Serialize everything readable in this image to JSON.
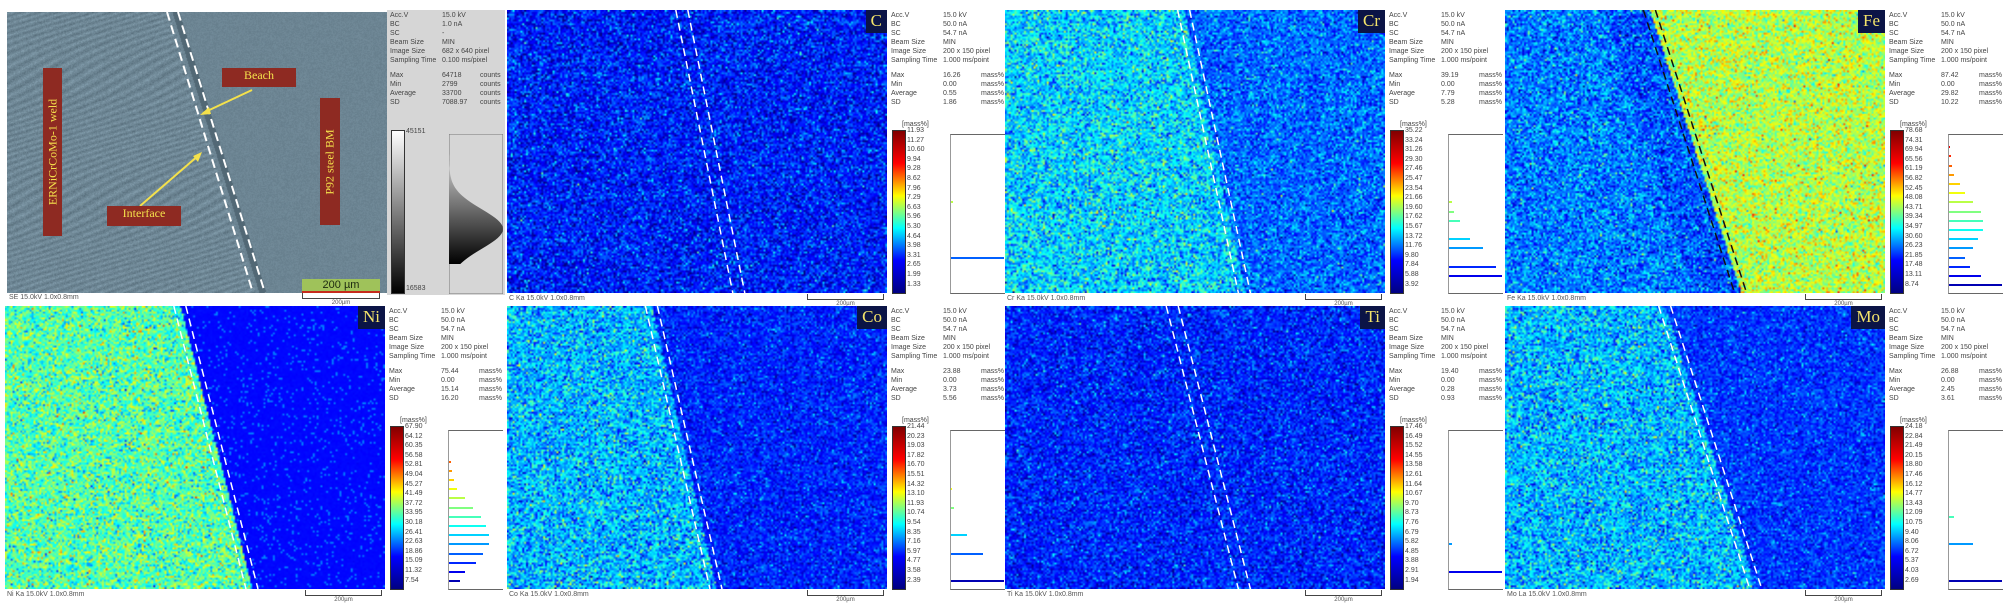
{
  "sem": {
    "labels": {
      "weld": "ERNiCrCoMo-1 weld",
      "beach": "Beach",
      "interface": "Interface",
      "base_metal": "P92 steel BM"
    },
    "scale_bar_label": "200 µm",
    "footer": "SE 15.0kV 1.0x0.8mm",
    "small_scale": "200µm",
    "params": [
      [
        "Acc.V",
        "15.0 kV"
      ],
      [
        "BC",
        "1.0 nA"
      ],
      [
        "SC",
        "-"
      ],
      [
        "Beam Size",
        "MIN"
      ],
      [
        "Image Size",
        "682 x 640 pixel"
      ],
      [
        "Sampling Time",
        "0.100 ms/pixel"
      ]
    ],
    "stats": [
      [
        "Max",
        "64718",
        "counts"
      ],
      [
        "Min",
        "2799",
        "counts"
      ],
      [
        "Average",
        "33700",
        "counts"
      ],
      [
        "SD",
        "7088.97",
        "counts"
      ]
    ],
    "scale_max": "45151",
    "scale_min": "16583",
    "annotation_color": "#8e2a22",
    "arrow_color": "#f4e14b"
  },
  "maps": [
    {
      "element": "C",
      "footer": "C Ka 15.0kV 1.0x0.8mm",
      "small_scale": "200µm",
      "unit": "[mass%]",
      "params": [
        [
          "Acc.V",
          "15.0 kV"
        ],
        [
          "BC",
          "50.0 nA"
        ],
        [
          "SC",
          "54.7 nA"
        ],
        [
          "Beam Size",
          "MIN"
        ],
        [
          "Image Size",
          "200 x 150 pixel"
        ],
        [
          "Sampling Time",
          "1.000 ms/point"
        ]
      ],
      "stats": [
        [
          "Max",
          "16.26",
          "mass%"
        ],
        [
          "Min",
          "0.00",
          "mass%"
        ],
        [
          "Average",
          "0.55",
          "mass%"
        ],
        [
          "SD",
          "1.86",
          "mass%"
        ]
      ],
      "levels": [
        "11.93",
        "11.27",
        "10.60",
        "9.94",
        "9.28",
        "8.62",
        "7.96",
        "7.29",
        "6.63",
        "5.96",
        "5.30",
        "4.64",
        "3.98",
        "3.31",
        "2.65",
        "1.99",
        "1.33"
      ],
      "histogram": [
        0,
        0,
        0,
        0,
        0,
        0,
        0,
        0.03,
        0,
        0,
        0,
        0,
        0,
        1.0,
        0,
        0,
        0
      ]
    },
    {
      "element": "Cr",
      "footer": "Cr Ka 15.0kV 1.0x0.8mm",
      "small_scale": "200µm",
      "unit": "[mass%]",
      "params": [
        [
          "Acc.V",
          "15.0 kV"
        ],
        [
          "BC",
          "50.0 nA"
        ],
        [
          "SC",
          "54.7 nA"
        ],
        [
          "Beam Size",
          "MIN"
        ],
        [
          "Image Size",
          "200 x 150 pixel"
        ],
        [
          "Sampling Time",
          "1.000 ms/point"
        ]
      ],
      "stats": [
        [
          "Max",
          "39.19",
          "mass%"
        ],
        [
          "Min",
          "0.00",
          "mass%"
        ],
        [
          "Average",
          "7.79",
          "mass%"
        ],
        [
          "SD",
          "5.28",
          "mass%"
        ]
      ],
      "levels": [
        "35.22",
        "33.24",
        "31.26",
        "29.30",
        "27.46",
        "25.47",
        "23.54",
        "21.66",
        "19.60",
        "17.62",
        "15.67",
        "13.72",
        "11.76",
        "9.80",
        "7.84",
        "5.88",
        "3.92"
      ],
      "histogram": [
        0,
        0,
        0,
        0,
        0,
        0,
        0,
        0.05,
        0.1,
        0.2,
        0,
        0.4,
        0.65,
        0,
        0.88,
        1.0,
        0
      ]
    },
    {
      "element": "Fe",
      "footer": "Fe Ka 15.0kV 1.0x0.8mm",
      "small_scale": "200µm",
      "unit": "[mass%]",
      "params": [
        [
          "Acc.V",
          "15.0 kV"
        ],
        [
          "BC",
          "50.0 nA"
        ],
        [
          "SC",
          "54.7 nA"
        ],
        [
          "Beam Size",
          "MIN"
        ],
        [
          "Image Size",
          "200 x 150 pixel"
        ],
        [
          "Sampling Time",
          "1.000 ms/point"
        ]
      ],
      "stats": [
        [
          "Max",
          "87.42",
          "mass%"
        ],
        [
          "Min",
          "0.00",
          "mass%"
        ],
        [
          "Average",
          "29.82",
          "mass%"
        ],
        [
          "SD",
          "10.22",
          "mass%"
        ]
      ],
      "levels": [
        "78.68",
        "74.31",
        "69.94",
        "65.56",
        "61.19",
        "56.82",
        "52.45",
        "48.08",
        "43.71",
        "39.34",
        "34.97",
        "30.60",
        "26.23",
        "21.85",
        "17.48",
        "13.11",
        "8.74"
      ],
      "histogram": [
        0,
        0.02,
        0.03,
        0.05,
        0.1,
        0.2,
        0.3,
        0.45,
        0.6,
        0.65,
        0.65,
        0.55,
        0.45,
        0.3,
        0.4,
        0.6,
        1.0
      ]
    },
    {
      "element": "Ni",
      "footer": "Ni Ka 15.0kV 1.0x0.8mm",
      "small_scale": "200µm",
      "unit": "[mass%]",
      "params": [
        [
          "Acc.V",
          "15.0 kV"
        ],
        [
          "BC",
          "50.0 nA"
        ],
        [
          "SC",
          "54.7 nA"
        ],
        [
          "Beam Size",
          "MIN"
        ],
        [
          "Image Size",
          "200 x 150 pixel"
        ],
        [
          "Sampling Time",
          "1.000 ms/point"
        ]
      ],
      "stats": [
        [
          "Max",
          "75.44",
          "mass%"
        ],
        [
          "Min",
          "0.00",
          "mass%"
        ],
        [
          "Average",
          "15.14",
          "mass%"
        ],
        [
          "SD",
          "16.20",
          "mass%"
        ]
      ],
      "levels": [
        "67.90",
        "64.12",
        "60.35",
        "56.58",
        "52.81",
        "49.04",
        "45.27",
        "41.49",
        "37.72",
        "33.95",
        "30.18",
        "26.41",
        "22.63",
        "18.86",
        "15.09",
        "11.32",
        "7.54"
      ],
      "histogram": [
        0,
        0,
        0,
        0.03,
        0.05,
        0.1,
        0.15,
        0.3,
        0.45,
        0.6,
        0.7,
        0.75,
        0.75,
        0.65,
        0.5,
        0.3,
        0.2
      ]
    },
    {
      "element": "Co",
      "footer": "Co Ka 15.0kV 1.0x0.8mm",
      "small_scale": "200µm",
      "unit": "[mass%]",
      "params": [
        [
          "Acc.V",
          "15.0 kV"
        ],
        [
          "BC",
          "50.0 nA"
        ],
        [
          "SC",
          "54.7 nA"
        ],
        [
          "Beam Size",
          "MIN"
        ],
        [
          "Image Size",
          "200 x 150 pixel"
        ],
        [
          "Sampling Time",
          "1.000 ms/point"
        ]
      ],
      "stats": [
        [
          "Max",
          "23.88",
          "mass%"
        ],
        [
          "Min",
          "0.00",
          "mass%"
        ],
        [
          "Average",
          "3.73",
          "mass%"
        ],
        [
          "SD",
          "5.56",
          "mass%"
        ]
      ],
      "levels": [
        "21.44",
        "20.23",
        "19.03",
        "17.82",
        "16.70",
        "15.51",
        "14.32",
        "13.10",
        "11.93",
        "10.74",
        "9.54",
        "8.35",
        "7.16",
        "5.97",
        "4.77",
        "3.58",
        "2.39"
      ],
      "histogram": [
        0,
        0,
        0,
        0,
        0,
        0,
        0.02,
        0,
        0.05,
        0,
        0,
        0.3,
        0,
        0.6,
        0,
        0,
        1.0
      ]
    },
    {
      "element": "Ti",
      "footer": "Ti Ka 15.0kV 1.0x0.8mm",
      "small_scale": "200µm",
      "unit": "[mass%]",
      "params": [
        [
          "Acc.V",
          "15.0 kV"
        ],
        [
          "BC",
          "50.0 nA"
        ],
        [
          "SC",
          "54.7 nA"
        ],
        [
          "Beam Size",
          "MIN"
        ],
        [
          "Image Size",
          "200 x 150 pixel"
        ],
        [
          "Sampling Time",
          "1.000 ms/point"
        ]
      ],
      "stats": [
        [
          "Max",
          "19.40",
          "mass%"
        ],
        [
          "Min",
          "0.00",
          "mass%"
        ],
        [
          "Average",
          "0.28",
          "mass%"
        ],
        [
          "SD",
          "0.93",
          "mass%"
        ]
      ],
      "levels": [
        "17.46",
        "16.49",
        "15.52",
        "14.55",
        "13.58",
        "12.61",
        "11.64",
        "10.67",
        "9.70",
        "8.73",
        "7.76",
        "6.79",
        "5.82",
        "4.85",
        "3.88",
        "2.91",
        "1.94"
      ],
      "histogram": [
        0,
        0,
        0,
        0,
        0,
        0,
        0,
        0,
        0,
        0,
        0,
        0,
        0.06,
        0,
        0,
        1.0,
        0
      ]
    },
    {
      "element": "Mo",
      "footer": "Mo La 15.0kV 1.0x0.8mm",
      "small_scale": "200µm",
      "unit": "[mass%]",
      "params": [
        [
          "Acc.V",
          "15.0 kV"
        ],
        [
          "BC",
          "50.0 nA"
        ],
        [
          "SC",
          "54.7 nA"
        ],
        [
          "Beam Size",
          "MIN"
        ],
        [
          "Image Size",
          "200 x 150 pixel"
        ],
        [
          "Sampling Time",
          "1.000 ms/point"
        ]
      ],
      "stats": [
        [
          "Max",
          "26.88",
          "mass%"
        ],
        [
          "Min",
          "0.00",
          "mass%"
        ],
        [
          "Average",
          "2.45",
          "mass%"
        ],
        [
          "SD",
          "3.61",
          "mass%"
        ]
      ],
      "levels": [
        "24.18",
        "22.84",
        "21.49",
        "20.15",
        "18.80",
        "17.46",
        "16.12",
        "14.77",
        "13.43",
        "12.09",
        "10.75",
        "9.40",
        "8.06",
        "6.72",
        "5.37",
        "4.03",
        "2.69"
      ],
      "histogram": [
        0,
        0,
        0,
        0,
        0,
        0,
        0,
        0,
        0,
        0.1,
        0,
        0,
        0.45,
        0,
        0,
        0,
        1.0
      ]
    }
  ]
}
